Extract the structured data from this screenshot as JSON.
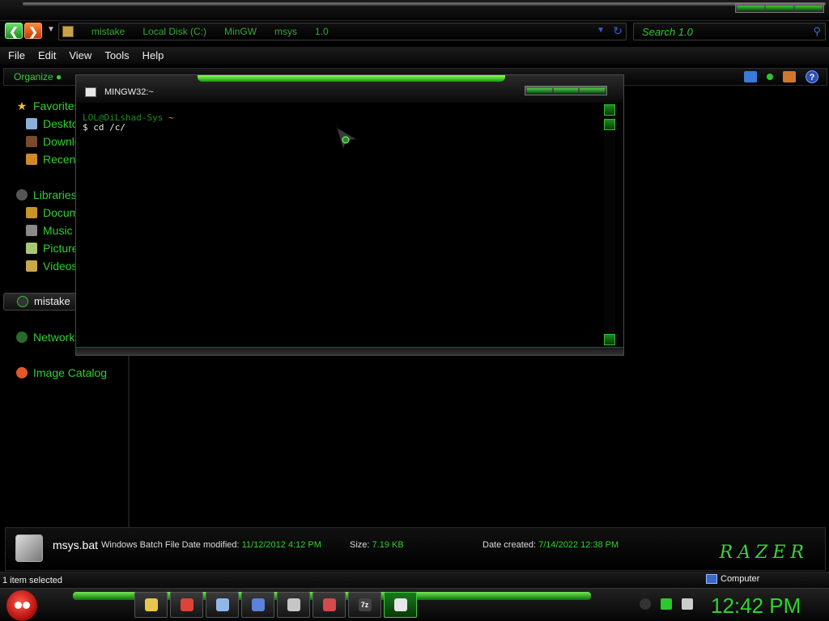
{
  "explorer": {
    "address": {
      "crumbs": [
        "mistake",
        "Local Disk (C:)",
        "MinGW",
        "msys",
        "1.0"
      ]
    },
    "search_placeholder": "Search 1.0",
    "menu": [
      "File",
      "Edit",
      "View",
      "Tools",
      "Help"
    ],
    "toolbar": {
      "organize": "Organize"
    },
    "sidebar": {
      "favorites": {
        "label": "Favorites",
        "items": [
          "Desktop",
          "Downloads",
          "Recent Places"
        ]
      },
      "libraries": {
        "label": "Libraries",
        "items": [
          "Documents",
          "Music",
          "Pictures",
          "Videos"
        ]
      },
      "homegroup": "mistake",
      "network": "Network",
      "image_catalog": "Image Catalog"
    },
    "details": {
      "file_name": "msys.bat",
      "file_type": "Windows Batch File",
      "date_modified_label": "Date modified:",
      "date_modified": "11/12/2012 4:12 PM",
      "size_label": "Size:",
      "size": "7.19 KB",
      "date_created_label": "Date created:",
      "date_created": "7/14/2022 12:38 PM",
      "brand": "RAZER"
    },
    "status": {
      "selection": "1 item selected",
      "location": "Computer"
    }
  },
  "console": {
    "title": "MINGW32:~",
    "prompt_user": "LOL@DiLshad-Sys",
    "prompt_dir": "~",
    "command_line": "$ cd /c/"
  },
  "taskbar": {
    "pinned": [
      {
        "name": "explorer",
        "icon": "folder-icon",
        "color": "#e9c64a"
      },
      {
        "name": "chrome",
        "icon": "chrome-icon",
        "color": "#db4437"
      },
      {
        "name": "notepad",
        "icon": "notepad-icon",
        "color": "#8fb8e8"
      },
      {
        "name": "monitor",
        "icon": "monitor-icon",
        "color": "#5a82d8"
      },
      {
        "name": "tools",
        "icon": "tools-icon",
        "color": "#c6c6c6"
      },
      {
        "name": "archive",
        "icon": "archive-icon",
        "color": "#d44a4a"
      },
      {
        "name": "7zip",
        "icon": "7zip-icon",
        "color": "#444444",
        "label": "7z"
      },
      {
        "name": "terminal",
        "icon": "terminal-icon",
        "color": "#e8e8e8",
        "active": true
      }
    ],
    "clock": "12:42 PM"
  },
  "colors": {
    "accent_green": "#2fcf2f",
    "background": "#000000"
  }
}
